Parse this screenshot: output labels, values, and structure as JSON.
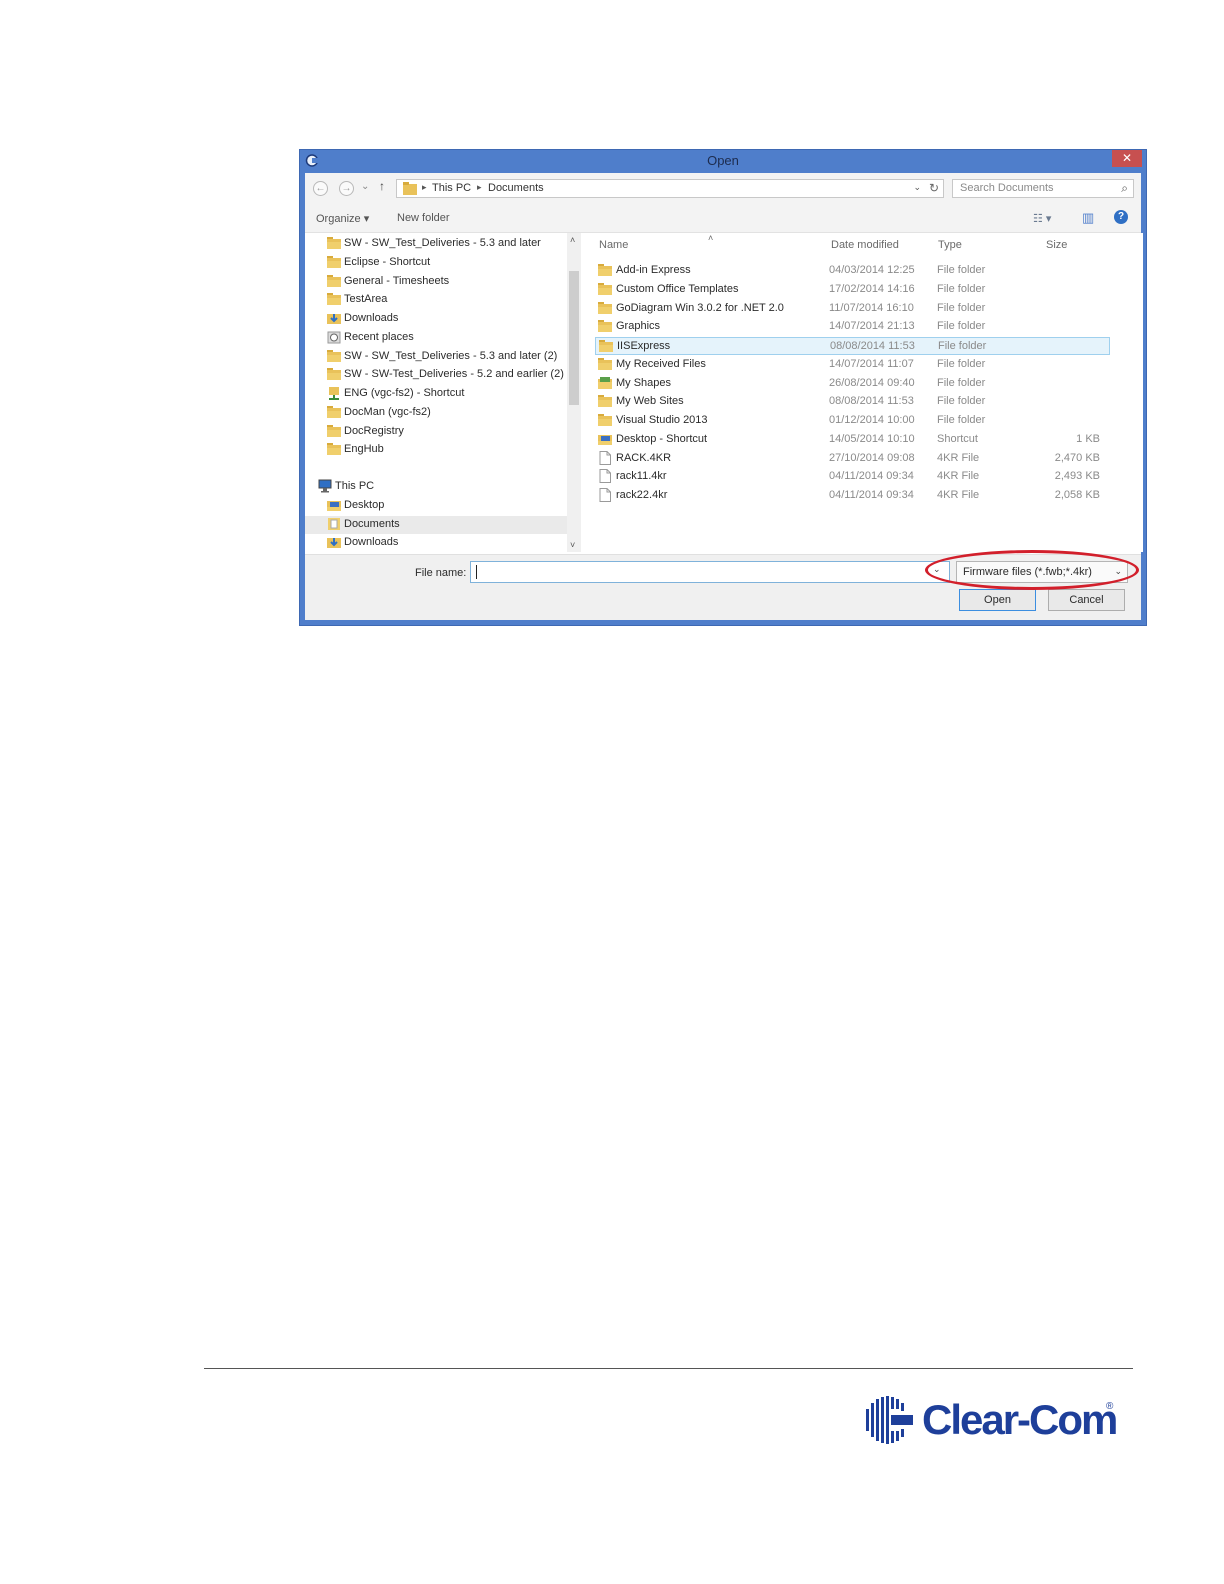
{
  "dialog": {
    "title": "Open",
    "close_glyph": "✕",
    "nav": {
      "back": "←",
      "forward": "→",
      "recent": "⌄",
      "up": "↑"
    },
    "breadcrumb": [
      "This PC",
      "Documents"
    ],
    "crumb_sep": "▸",
    "addr_dropdown": "⌄",
    "refresh_glyph": "↻",
    "search_placeholder": "Search Documents",
    "search_glyph": "⌕",
    "toolbar": {
      "organize": "Organize ▾",
      "new_folder": "New folder",
      "views_glyph": "☷ ▾",
      "preview_glyph": "▥",
      "help_glyph": "?"
    },
    "nav_pane": [
      {
        "label": "SW - SW_Test_Deliveries - 5.3 and later",
        "icon": "folder-shortcut-icon"
      },
      {
        "label": "Eclipse - Shortcut",
        "icon": "folder-shortcut-icon"
      },
      {
        "label": "General - Timesheets",
        "icon": "folder-shortcut-icon"
      },
      {
        "label": "TestArea",
        "icon": "folder-shortcut-icon"
      },
      {
        "label": "Downloads",
        "icon": "downloads-icon"
      },
      {
        "label": "Recent places",
        "icon": "recent-places-icon"
      },
      {
        "label": "SW - SW_Test_Deliveries - 5.3 and later (2)",
        "icon": "folder-shortcut-icon"
      },
      {
        "label": "SW - SW-Test_Deliveries - 5.2 and earlier (2)",
        "icon": "folder-shortcut-icon"
      },
      {
        "label": "ENG (vgc-fs2) - Shortcut",
        "icon": "network-folder-icon"
      },
      {
        "label": "DocMan (vgc-fs2)",
        "icon": "folder-shortcut-icon"
      },
      {
        "label": "DocRegistry",
        "icon": "folder-shortcut-icon"
      },
      {
        "label": "EngHub",
        "icon": "folder-shortcut-icon"
      }
    ],
    "this_pc": {
      "label": "This PC",
      "children": [
        {
          "label": "Desktop",
          "icon": "desktop-icon"
        },
        {
          "label": "Documents",
          "icon": "documents-icon",
          "selected": true
        },
        {
          "label": "Downloads",
          "icon": "downloads-icon"
        }
      ]
    },
    "scroll_up": "˄",
    "scroll_down": "˅",
    "columns": {
      "name": "Name",
      "date": "Date modified",
      "type": "Type",
      "size": "Size",
      "sort_glyph": "˄"
    },
    "files": [
      {
        "name": "Add-in Express",
        "date": "04/03/2014 12:25",
        "type": "File folder",
        "size": "",
        "icon": "folder-icon"
      },
      {
        "name": "Custom Office Templates",
        "date": "17/02/2014 14:16",
        "type": "File folder",
        "size": "",
        "icon": "folder-icon"
      },
      {
        "name": "GoDiagram Win 3.0.2 for .NET 2.0",
        "date": "11/07/2014 16:10",
        "type": "File folder",
        "size": "",
        "icon": "folder-icon"
      },
      {
        "name": "Graphics",
        "date": "14/07/2014 21:13",
        "type": "File folder",
        "size": "",
        "icon": "folder-icon"
      },
      {
        "name": "IISExpress",
        "date": "08/08/2014 11:53",
        "type": "File folder",
        "size": "",
        "icon": "folder-icon",
        "selected": true
      },
      {
        "name": "My Received Files",
        "date": "14/07/2014 11:07",
        "type": "File folder",
        "size": "",
        "icon": "folder-icon"
      },
      {
        "name": "My Shapes",
        "date": "26/08/2014 09:40",
        "type": "File folder",
        "size": "",
        "icon": "shapes-folder-icon"
      },
      {
        "name": "My Web Sites",
        "date": "08/08/2014 11:53",
        "type": "File folder",
        "size": "",
        "icon": "folder-icon"
      },
      {
        "name": "Visual Studio 2013",
        "date": "01/12/2014 10:00",
        "type": "File folder",
        "size": "",
        "icon": "folder-icon"
      },
      {
        "name": "Desktop - Shortcut",
        "date": "14/05/2014 10:10",
        "type": "Shortcut",
        "size": "1 KB",
        "icon": "desktop-shortcut-icon"
      },
      {
        "name": "RACK.4KR",
        "date": "27/10/2014 09:08",
        "type": "4KR File",
        "size": "2,470 KB",
        "icon": "file-icon"
      },
      {
        "name": "rack11.4kr",
        "date": "04/11/2014 09:34",
        "type": "4KR File",
        "size": "2,493 KB",
        "icon": "file-icon"
      },
      {
        "name": "rack22.4kr",
        "date": "04/11/2014 09:34",
        "type": "4KR File",
        "size": "2,058 KB",
        "icon": "file-icon"
      }
    ],
    "file_name_label": "File name:",
    "file_name_value": "",
    "dropdown_glyph": "⌄",
    "filter": "Firmware files (*.fwb;*.4kr)",
    "open_button": "Open",
    "cancel_button": "Cancel"
  },
  "logo": {
    "text": "Clear-Com",
    "reg": "®"
  },
  "colors": {
    "window_frame": "#4f7ecb",
    "close_button": "#c75050",
    "highlight_ellipse": "#d21f2b",
    "selection": "#e5f3fb",
    "logo_blue": "#1e3f9a"
  }
}
